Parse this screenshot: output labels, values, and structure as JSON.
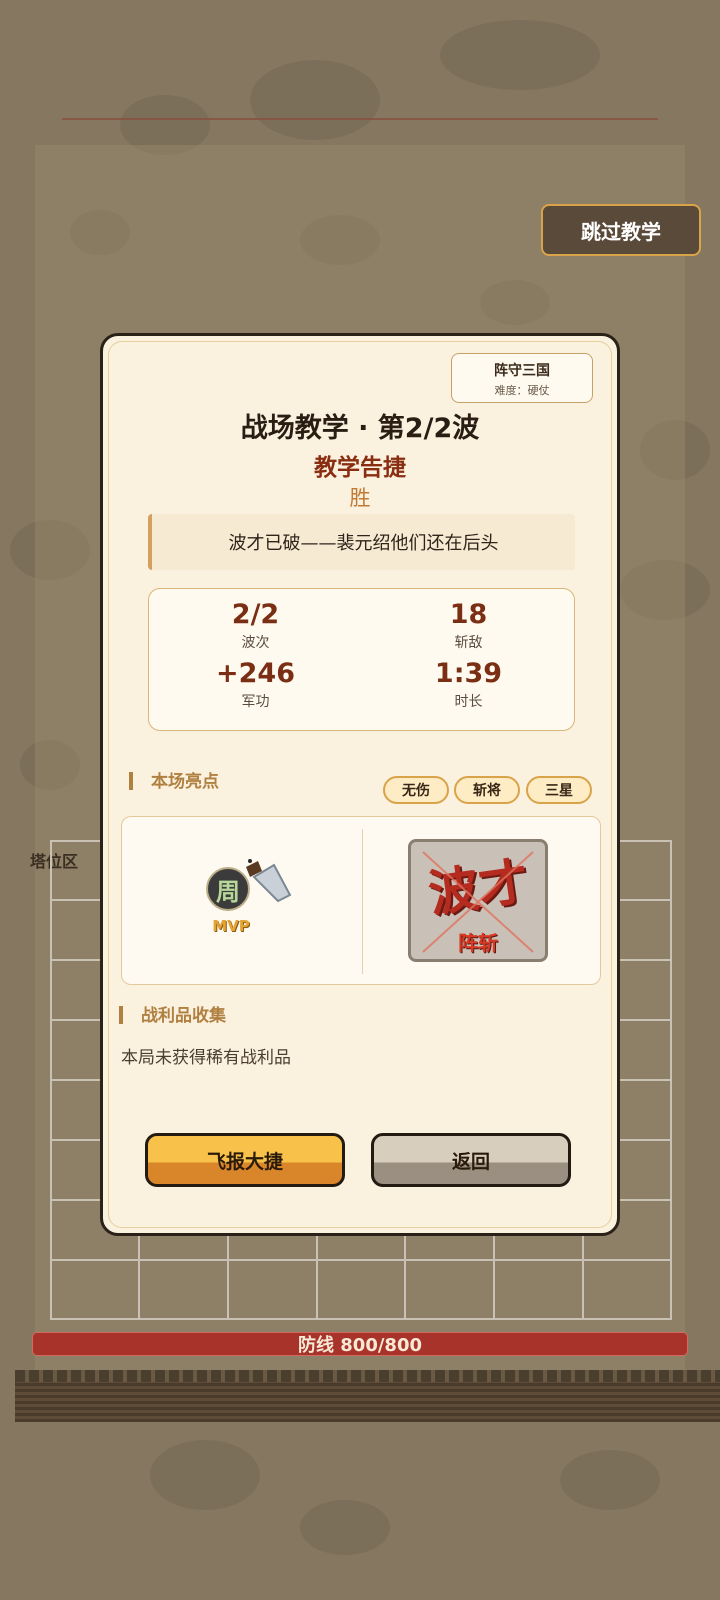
{
  "header": {
    "skip_label": "跳过教学"
  },
  "board": {
    "tower_zone_label": "塔位区",
    "defense_label": "防线 800/800"
  },
  "modal": {
    "game_name": "阵守三国",
    "difficulty": "难度：硬仗",
    "title": "战场教学 · 第2/2波",
    "subtitle": "教学告捷",
    "result": "胜",
    "quote": "波才已破——裴元绍他们还在后头",
    "stats": [
      {
        "value": "2/2",
        "label": "波次"
      },
      {
        "value": "18",
        "label": "斩敌"
      },
      {
        "value": "+246",
        "label": "军功"
      },
      {
        "value": "1:39",
        "label": "时长"
      }
    ],
    "highlights": {
      "heading": "本场亮点",
      "badges": [
        "无伤",
        "斩将",
        "三星"
      ],
      "mvp_hero": "周",
      "mvp_label": "MVP",
      "kill_name": "波才",
      "kill_label": "阵斩"
    },
    "loot": {
      "heading": "战利品收集",
      "text": "本局未获得稀有战利品"
    },
    "buttons": {
      "primary": "飞报大捷",
      "secondary": "返回"
    }
  },
  "colors": {
    "accent": "#d9a34a",
    "title_red": "#8a2e12",
    "defense_bar": "#a8332a"
  }
}
